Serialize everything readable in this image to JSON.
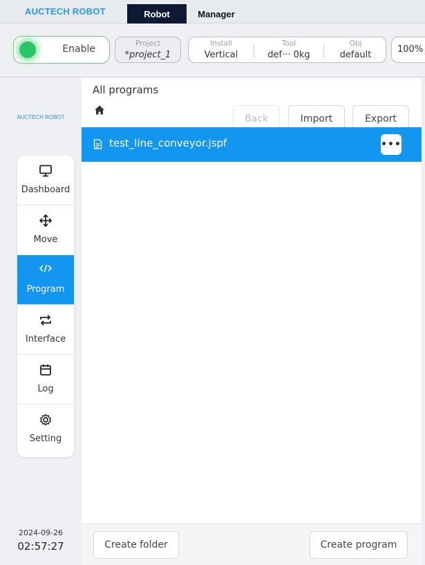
{
  "topbar": {
    "brand": "AUCTECH ROBOT",
    "tabs": [
      "Robot",
      "Manager"
    ]
  },
  "status": {
    "enable_label": "Enable",
    "project": {
      "caption": "Project",
      "value": "*project_1"
    },
    "install": {
      "caption": "Install",
      "value": "Vertical"
    },
    "tool": {
      "caption": "Tool",
      "value": "def··· 0kg"
    },
    "obj": {
      "caption": "Obj",
      "value": "default"
    },
    "speed": "100%"
  },
  "sidebar": {
    "brand": "AUCTECH ROBOT",
    "items": [
      {
        "label": "Dashboard",
        "icon": "monitor-icon"
      },
      {
        "label": "Move",
        "icon": "move-arrows-icon"
      },
      {
        "label": "Program",
        "icon": "code-icon",
        "active": true
      },
      {
        "label": "Interface",
        "icon": "swap-arrows-icon"
      },
      {
        "label": "Log",
        "icon": "calendar-icon"
      },
      {
        "label": "Setting",
        "icon": "gear-icon"
      }
    ],
    "date": "2024-09-26",
    "time": "02:57:27"
  },
  "main": {
    "title": "All programs",
    "buttons": {
      "back": "Back",
      "import": "Import",
      "export": "Export"
    },
    "files": [
      {
        "name": "test_line_conveyor.jspf",
        "more": "•••"
      }
    ],
    "footer": {
      "create_folder": "Create folder",
      "create_program": "Create program"
    }
  },
  "colors": {
    "accent": "#1296f0",
    "brand": "#2a98e6",
    "enable_green": "#27c765",
    "tab_dark": "#0e1a33"
  }
}
